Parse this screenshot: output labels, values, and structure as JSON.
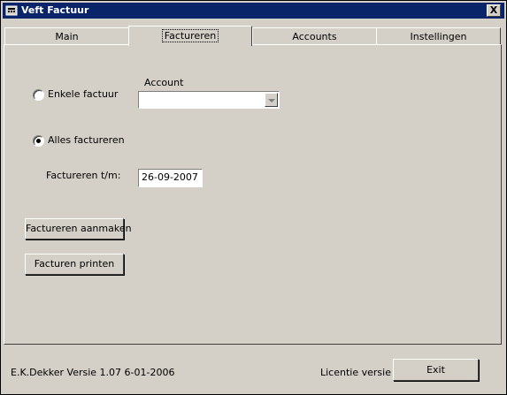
{
  "window": {
    "title": "Veft Factuur",
    "close_label": "X"
  },
  "tabs": [
    {
      "label": "Main",
      "active": false
    },
    {
      "label": "Factureren",
      "active": true
    },
    {
      "label": "Accounts",
      "active": false
    },
    {
      "label": "Instellingen",
      "active": false
    }
  ],
  "form": {
    "single_invoice_label": "Enkele factuur",
    "account_label": "Account",
    "account_value": "",
    "all_invoice_label": "Alles factureren",
    "selected_option": "all",
    "invoice_until_label": "Factureren t/m:",
    "invoice_until_value": "26-09-2007",
    "create_button": "Factureren aanmaken",
    "print_button": "Facturen printen"
  },
  "footer": {
    "version_text": "E.K.Dekker  Versie 1.07  6-01-2006",
    "license_text": "Licentie versie",
    "exit_button": "Exit"
  },
  "icons": [
    "app-window-icon",
    "close-icon",
    "dropdown-arrow-icon"
  ]
}
